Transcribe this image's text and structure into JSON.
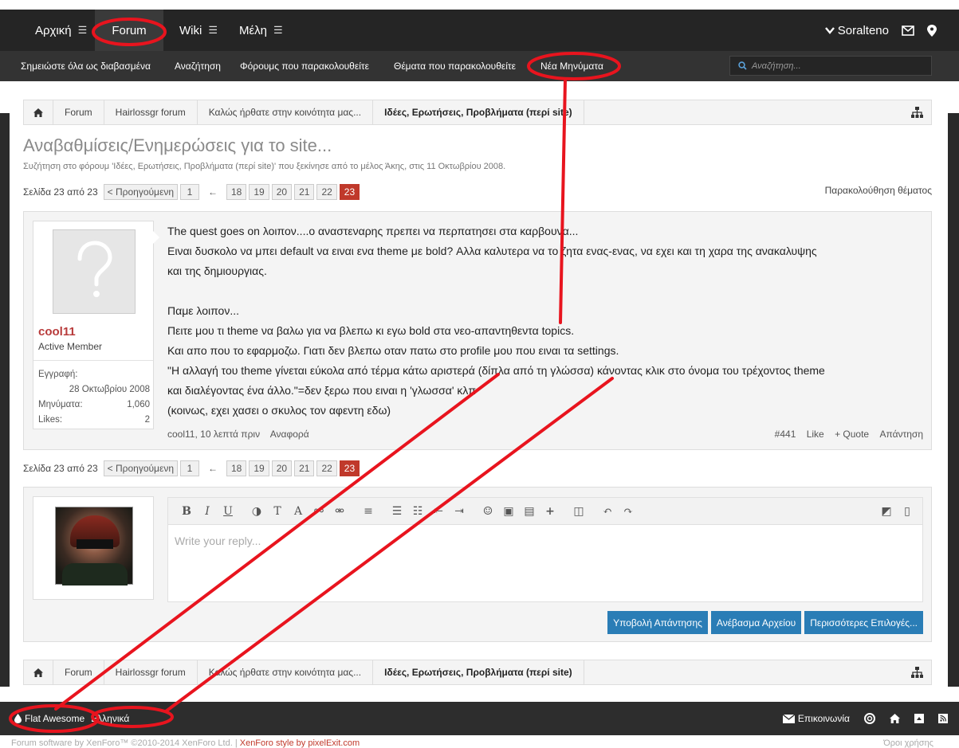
{
  "nav": {
    "items": [
      {
        "label": "Αρχική",
        "hamburger": true
      },
      {
        "label": "Forum",
        "active": true
      },
      {
        "label": "Wiki",
        "hamburger": true
      },
      {
        "label": "Μέλη",
        "hamburger": true
      }
    ],
    "username": "Soralteno"
  },
  "subnav": {
    "links": [
      "Σημειώστε όλα ως διαβασμένα",
      "Αναζήτηση",
      "Φόρουμς που παρακολουθείτε",
      "Θέματα που παρακολουθείτε",
      "Νέα Μηνύματα"
    ],
    "search_placeholder": "Αναζήτηση..."
  },
  "breadcrumb": [
    "Forum",
    "Hairlossgr forum",
    "Καλώς ήρθατε στην κοινότητα μας...",
    "Ιδέες, Ερωτήσεις, Προβλήματα (περί site)"
  ],
  "thread": {
    "title": "Αναβαθμίσεις/Ενημερώσεις για το site...",
    "meta": "Συζήτηση στο φόρουμ 'Ιδέες, Ερωτήσεις, Προβλήματα (περί site)' που ξεκίνησε από το μέλος Άκης, στις 11 Οκτωβρίου 2008.",
    "watch_label": "Παρακολούθηση θέματος"
  },
  "pagination": {
    "page_label": "Σελίδα 23 από 23",
    "prev_label": "< Προηγούμενη",
    "first": "1",
    "arrow": "←",
    "pages": [
      "18",
      "19",
      "20",
      "21",
      "22",
      "23"
    ],
    "current": "23"
  },
  "post": {
    "author": "cool11",
    "author_title": "Active Member",
    "stats": {
      "joined_label": "Εγγραφή:",
      "joined_value": "28 Οκτωβρίου 2008",
      "messages_label": "Μηνύματα:",
      "messages_value": "1,060",
      "likes_label": "Likes:",
      "likes_value": "2"
    },
    "lines": [
      "The quest goes on λοιπον....ο αναστεναρης πρεπει να περπατησει στα καρβουνα...",
      "Ειναι δυσκολο να μπει default να ειναι ενα theme με bold? Αλλα καλυτερα να το ζητα ενας-ενας, να εχει και τη χαρα της ανακαλυψης",
      "και της δημιουργιας.",
      "",
      "Παμε λοιπον...",
      "Πειτε μου τι theme να βαλω για να βλεπω κι εγω bold στα νεο-απαντηθεντα topics.",
      "Και απο πoυ το εφαρμοζω. Γιατι δεν βλεπω οταν πατω στο profile μου που ειναι τα settings.",
      "\"Η αλλαγή του theme γίνεται εύκολα από τέρμα κάτω αριστερά (δίπλα από τη γλώσσα) κάνοντας κλικ στο όνομα του τρέχοντος theme",
      "και διαλέγοντας ένα άλλο.\"=δεν ξερω που ειναι η 'γλωσσα' κλπ",
      "(κοινως, εχει χασει ο σκυλος τον αφεντη εδω)"
    ],
    "footer_left_author_time": "cool11, 10 λεπτά πριν",
    "footer_report": "Αναφορά",
    "footer_number": "#441",
    "footer_like": "Like",
    "footer_quote": "+ Quote",
    "footer_reply": "Απάντηση"
  },
  "reply": {
    "placeholder": "Write your reply...",
    "buttons": {
      "submit": "Υποβολή Απάντησης",
      "upload": "Ανέβασμα Αρχείου",
      "more": "Περισσότερες Επιλογές..."
    }
  },
  "footer": {
    "style": "Flat Awesome",
    "language": "Ελληνικά",
    "contact": "Επικοινωνία",
    "copyright": "Forum software by XenForo™ ©2010-2014 XenForo Ltd.",
    "style_credit": "XenForo style by pixelExit.com",
    "terms": "Όροι χρήσης"
  },
  "colors": {
    "header": "#252525",
    "subnav": "#333333",
    "accent_red": "#c0392b",
    "button_blue": "#2a7db6",
    "annotation_red": "#e8141e"
  }
}
